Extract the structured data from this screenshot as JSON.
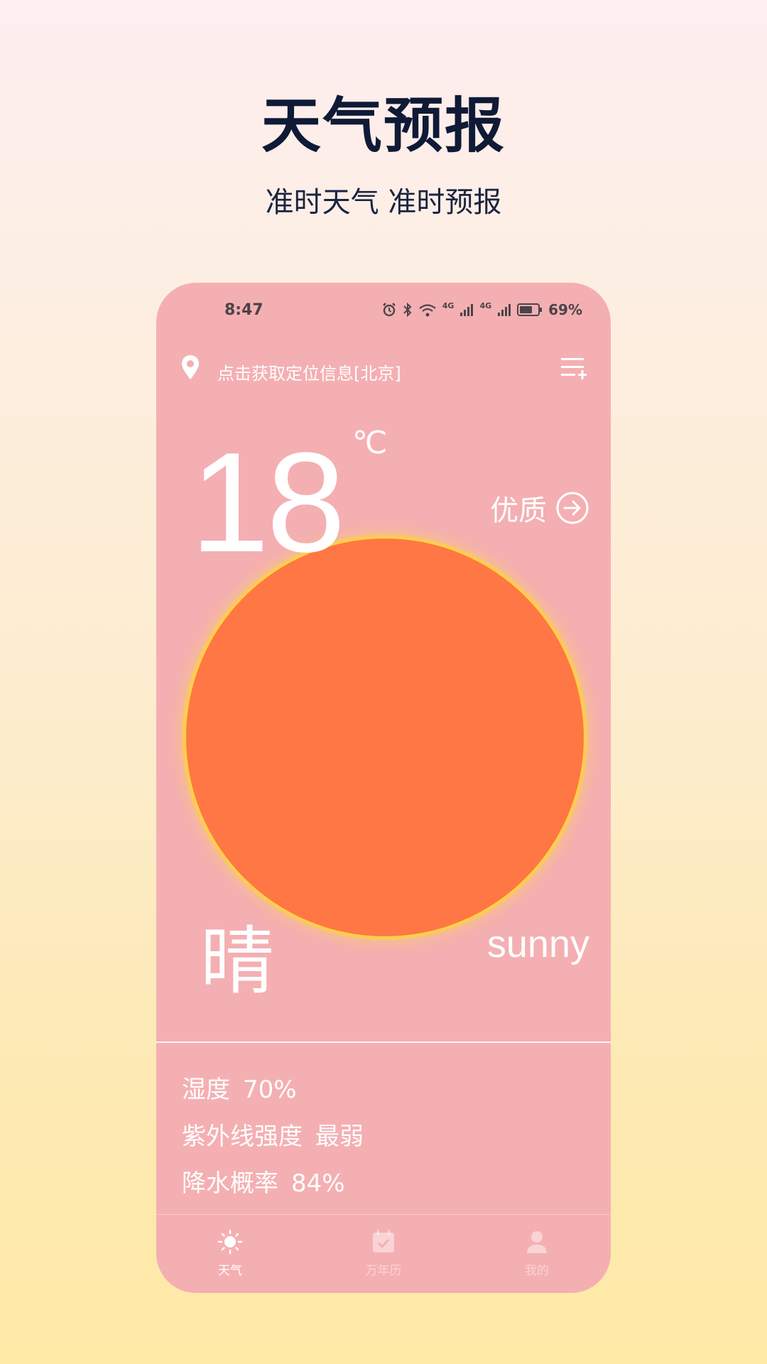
{
  "promo": {
    "title": "天气预报",
    "subtitle": "准时天气 准时预报"
  },
  "status_bar": {
    "time": "8:47",
    "battery": "69%",
    "network_1": "4G",
    "network_2": "4G"
  },
  "location": {
    "text": "点击获取定位信息[北京]"
  },
  "current": {
    "temperature": "18",
    "unit": "℃",
    "air_quality": "优质",
    "condition_cn": "晴",
    "condition_en": "sunny"
  },
  "details": [
    {
      "label": "湿度",
      "value": "70%"
    },
    {
      "label": "紫外线强度",
      "value": "最弱"
    },
    {
      "label": "降水概率",
      "value": "84%"
    }
  ],
  "tabs": [
    {
      "label": "天气",
      "icon": "sun-icon",
      "active": true
    },
    {
      "label": "万年历",
      "icon": "calendar-icon",
      "active": false
    },
    {
      "label": "我的",
      "icon": "person-icon",
      "active": false
    }
  ],
  "colors": {
    "phone_bg": "#f4afb2",
    "sun": "#ff7744",
    "sun_glow": "#ffd33d",
    "title": "#0f1a36"
  }
}
